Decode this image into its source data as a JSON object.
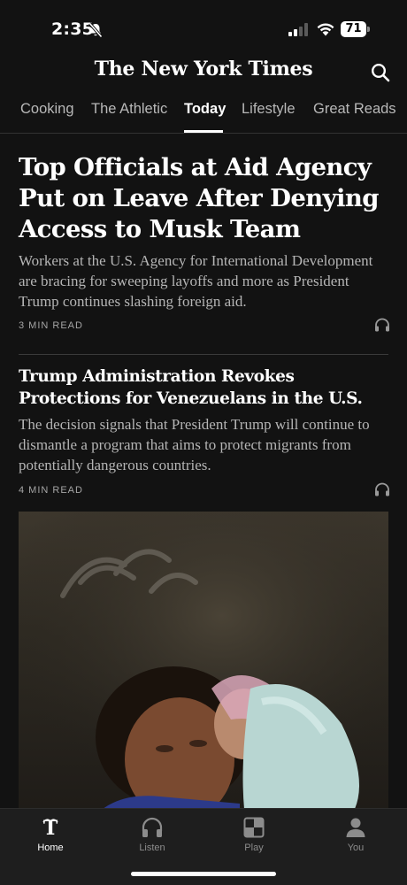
{
  "status_bar": {
    "time": "2:35",
    "battery": "71",
    "icons": [
      "bell-slash-icon",
      "signal-icon",
      "wifi-icon",
      "battery-icon"
    ]
  },
  "header": {
    "masthead": "The New York Times",
    "search_icon": "search-icon"
  },
  "tabs": [
    {
      "label": "Cooking"
    },
    {
      "label": "The Athletic"
    },
    {
      "label": "Today",
      "active": true
    },
    {
      "label": "Lifestyle"
    },
    {
      "label": "Great Reads"
    }
  ],
  "articles": [
    {
      "headline": "Top Officials at Aid Agency Put on Leave After Denying Access to Musk Team",
      "summary": "Workers at the U.S. Agency for International Development are bracing for sweeping layoffs and more as President Trump continues slashing foreign aid.",
      "read_time": "3 MIN READ"
    },
    {
      "headline": "Trump Administration Revokes Protections for Venezuelans in the U.S.",
      "summary": "The decision signals that President Trump will continue to dismantle a program that aims to protect migrants from potentially dangerous countries.",
      "read_time": "4 MIN READ"
    }
  ],
  "bottom_nav": [
    {
      "label": "Home",
      "icon": "nyt-logo-icon",
      "active": true
    },
    {
      "label": "Listen",
      "icon": "headphones-icon"
    },
    {
      "label": "Play",
      "icon": "play-grid-icon"
    },
    {
      "label": "You",
      "icon": "person-icon"
    }
  ],
  "colors": {
    "background": "#121212",
    "text": "#ffffff",
    "secondary_text": "#b5b5b5",
    "nav_background": "#1e1e1e"
  }
}
